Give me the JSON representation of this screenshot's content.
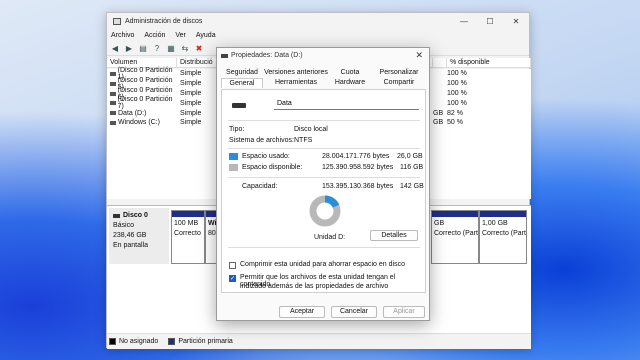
{
  "disk_mgmt": {
    "title": "Administración de discos",
    "menu": [
      "Archivo",
      "Acción",
      "Ver",
      "Ayuda"
    ],
    "columns": [
      "Volumen",
      "Distribució",
      "",
      "",
      "",
      "",
      "% disponible"
    ],
    "volumes": [
      {
        "name": "(Disco 0 Partición 1)",
        "layout": "Simple",
        "free_right": "",
        "pct": "100 %"
      },
      {
        "name": "(Disco 0 Partición 5)",
        "layout": "Simple",
        "free_right": "",
        "pct": "100 %"
      },
      {
        "name": "(Disco 0 Partición 6)",
        "layout": "Simple",
        "free_right": "",
        "pct": "100 %"
      },
      {
        "name": "(Disco 0 Partición 7)",
        "layout": "Simple",
        "free_right": "",
        "pct": "100 %"
      },
      {
        "name": "Data (D:)",
        "layout": "Simple",
        "free_right": "GB",
        "pct": "82 %"
      },
      {
        "name": "Windows (C:)",
        "layout": "Simple",
        "free_right": "GB",
        "pct": "50 %"
      }
    ],
    "disk0": {
      "name": "Disco 0",
      "type": "Básico",
      "size": "238,46 GB",
      "status": "En pantalla"
    },
    "partitions": [
      {
        "line1": "100 MB",
        "line2": "Correcto"
      },
      {
        "line1": "Wi",
        "line2": "80,"
      },
      {
        "line1": "GB",
        "line2": "Correcto (Partición c"
      },
      {
        "line1": "1,00 GB",
        "line2": "Correcto (Part"
      }
    ],
    "legend": [
      {
        "label": "No asignado",
        "color": "#000000"
      },
      {
        "label": "Partición primaria",
        "color": "#1f2e8c"
      }
    ]
  },
  "dialog": {
    "title": "Propiedades: Data (D:)",
    "tabs_row1": [
      "Seguridad",
      "Versiones anteriores",
      "Cuota",
      "Personalizar"
    ],
    "tabs_row2": [
      "General",
      "Herramientas",
      "Hardware",
      "Compartir"
    ],
    "volume_name": "Data",
    "type_label": "Tipo:",
    "type_value": "Disco local",
    "fs_label": "Sistema de archivos:",
    "fs_value": "NTFS",
    "used_label": "Espacio usado:",
    "used_bytes": "28.004.171.776 bytes",
    "used_gb": "26,0 GB",
    "free_label": "Espacio disponible:",
    "free_bytes": "125.390.958.592 bytes",
    "free_gb": "116 GB",
    "cap_label": "Capacidad:",
    "cap_bytes": "153.395.130.368 bytes",
    "cap_gb": "142 GB",
    "unit_label": "Unidad D:",
    "details_button": "Detalles",
    "compress_label": "Comprimir esta unidad para ahorrar espacio en disco",
    "index_label_1": "Permitir que los archivos de esta unidad tengan el contenido",
    "index_label_2": "indizado además de las propiedades de archivo",
    "compress_checked": false,
    "index_checked": true,
    "used_fraction": 0.183,
    "colors": {
      "used": "#2a8fd8",
      "free": "#b8b8b8"
    },
    "ok_button": "Aceptar",
    "cancel_button": "Cancelar",
    "apply_button": "Aplicar"
  }
}
